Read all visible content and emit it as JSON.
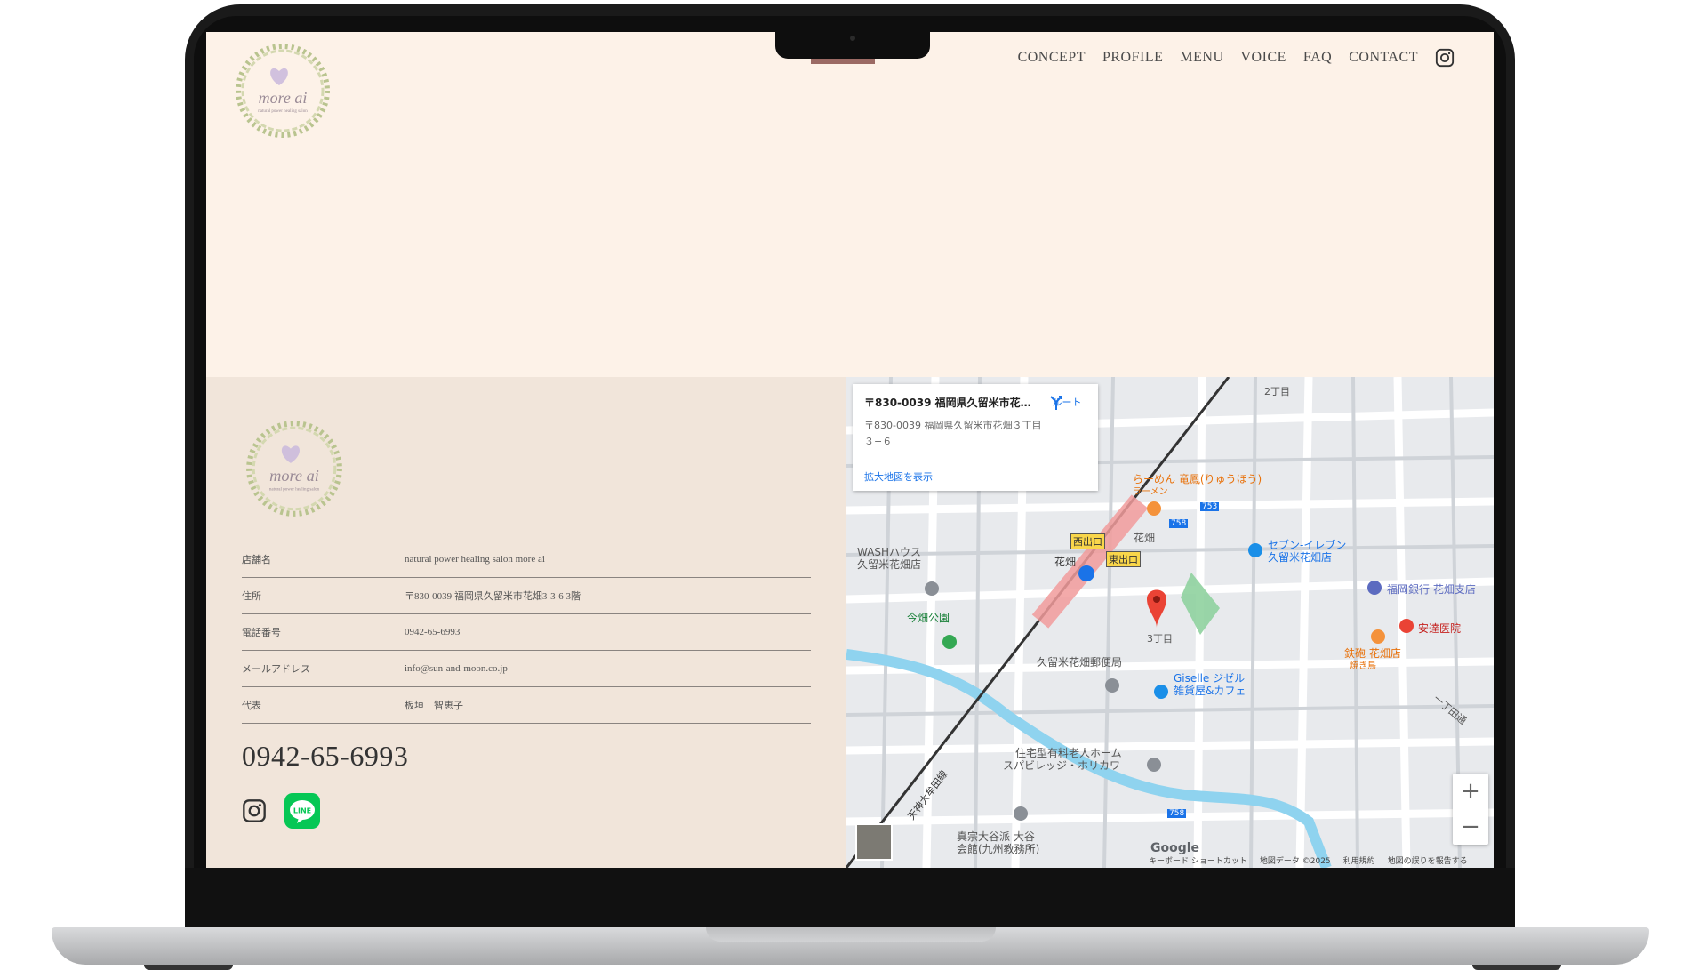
{
  "nav": {
    "items": [
      "CONCEPT",
      "PROFILE",
      "MENU",
      "VOICE",
      "FAQ",
      "CONTACT"
    ],
    "icon": "instagram-icon"
  },
  "logo": {
    "line1": "more ai",
    "line2": "natural power healing salon"
  },
  "info": [
    {
      "label": "店舗名",
      "value": "natural power healing salon more ai"
    },
    {
      "label": "住所",
      "value": "〒830-0039 福岡県久留米市花畑3-3-6 3階"
    },
    {
      "label": "電話番号",
      "value": "0942-65-6993"
    },
    {
      "label": "メールアドレス",
      "value": "info@sun-and-moon.co.jp"
    },
    {
      "label": "代表",
      "value": "板垣　智恵子"
    }
  ],
  "phone": "0942-65-6993",
  "social": {
    "line_label": "LINE"
  },
  "map": {
    "card_title": "〒830-0039 福岡県久留米市花…",
    "card_address": "〒830-0039 福岡県久留米市花畑３丁目３−６",
    "card_link": "拡大地図を表示",
    "route_label": "ルート",
    "labels": {
      "ramen": "らーめん 竜鳳(りゅうほう)",
      "ramen_sub": "ラーメン",
      "seven": "セブン-イレブン",
      "seven_sub": "久留米花畑店",
      "bank": "福岡銀行 花畑支店",
      "clinic": "安達医院",
      "tetsu": "鉄砲 花畑店",
      "tetsu_sub": "焼き鳥",
      "wash": "WASHハウス",
      "wash_sub": "久留米花畑店",
      "park": "今畑公園",
      "post": "久留米花畑郵便局",
      "giselle": "Giselle ジゼル",
      "giselle_sub": "雑貨屋&カフェ",
      "home": "住宅型有料老人ホーム",
      "home_sub": "スパビレッジ・ホリカワ",
      "church": "真宗大谷派 大谷",
      "church_sub": "会館(九州教務所)",
      "west": "西出口",
      "east": "東出口",
      "station": "花畑",
      "station2": "花畑",
      "chome2": "2丁目",
      "chome3": "3丁目",
      "icchome": "一丁田通",
      "line_name": "天神大牟田線",
      "r753": "753",
      "r758": "758",
      "r758b": "758"
    },
    "google": "Google",
    "bottom": [
      "キーボード ショートカット",
      "地図データ ©2025",
      "利用規約",
      "地図の誤りを報告する"
    ],
    "zoom_in": "+",
    "zoom_out": "−"
  }
}
